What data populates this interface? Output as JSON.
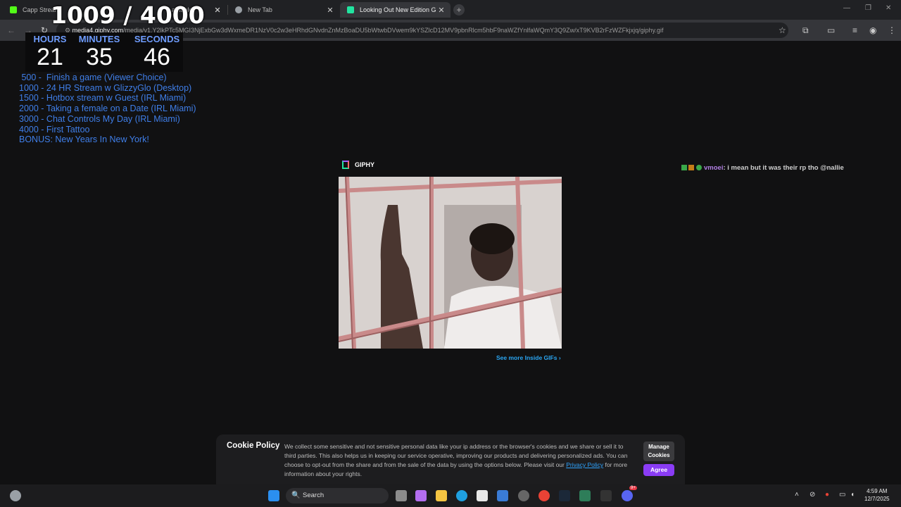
{
  "tabs": [
    {
      "title": "Capp Stream",
      "favicon_color": "#53fc18"
    },
    {
      "title": "amable",
      "favicon_color": "#4c8bf5"
    },
    {
      "title": "New Tab",
      "favicon_color": "#9aa0a6"
    },
    {
      "title": "Looking Out New Edition GIF b",
      "favicon_color": "#21e4a0"
    }
  ],
  "url": {
    "host": "media4.giphy.com",
    "path": "/media/v1.Y2lkPTc5MGI3NjExbGw3dWxmeDR1NzV0c2w3eHRhdGNvdnZnMzBoaDU5bWtwbDVwem9kYSZlcD12MV9pbnRlcm5hbF9naWZfYnlfaWQmY3Q9Zw/xT9KVB2rFzWZFkjxjq/giphy.gif"
  },
  "overlay": {
    "counter": "1009 / 4000",
    "timer": [
      {
        "label": "HOURS",
        "value": "21"
      },
      {
        "label": "MINUTES",
        "value": "35"
      },
      {
        "label": "SECONDS",
        "value": "46"
      }
    ],
    "goals": [
      " 500 -  Finish a game (Viewer Choice)",
      "1000 - 24 HR Stream w GlizzyGlo (Desktop)",
      "1500 - Hotbox stream w Guest (IRL Miami)",
      "2000 - Taking a female on a Date (IRL Miami)",
      "3000 - Chat Controls My Day (IRL Miami)",
      "4000 - First Tattoo",
      "BONUS: New Years In New York!"
    ]
  },
  "giphy": {
    "brand": "GIPHY",
    "see_more": "See more Inside GIFs"
  },
  "chat": {
    "username": "vmoei",
    "message": "i mean but it was their rp tho @nallie"
  },
  "cookie": {
    "title": "Cookie Policy",
    "body_before_link": "We collect some sensitive and not sensitive personal data like your ip address or the browser's cookies and we share or sell it to third parties. This also helps us in keeping our service operative, improving our products and delivering personalized ads. You can choose to opt-out from the share and from the sale of the data by using the options below. Please visit our ",
    "link": "Privacy Policy",
    "body_after_link": " for more information about your rights.",
    "manage": "Manage Cookies",
    "agree": "Agree"
  },
  "taskbar": {
    "search": "Search",
    "time": "4:59 AM",
    "date": "12/7/2025",
    "discord_badge": "9+"
  }
}
